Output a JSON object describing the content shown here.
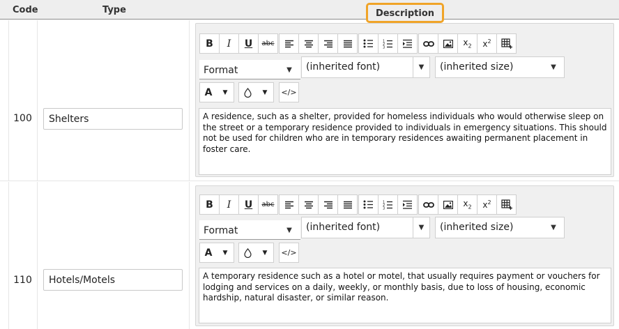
{
  "table": {
    "headers": {
      "code": "Code",
      "type": "Type",
      "description": "Description"
    },
    "rows": [
      {
        "code": "100",
        "type": "Shelters",
        "description": "A residence, such as a shelter, provided for homeless individuals who would otherwise sleep on the street or a temporary residence provided to individuals in emergency situations. This should not be used for children who are in temporary residences awaiting permanent placement in foster care."
      },
      {
        "code": "110",
        "type": "Hotels/Motels",
        "description": "A temporary residence such as a hotel or motel, that usually requires payment or vouchers for lodging and services on a daily, weekly, or monthly basis, due to loss of housing, economic hardship, natural disaster, or similar reason."
      }
    ]
  },
  "editor": {
    "toolbar": {
      "bold": "B",
      "italic": "I",
      "underline": "U",
      "strikethrough": "abc",
      "subscript_icon": "subscript-icon",
      "superscript_icon": "superscript-icon"
    },
    "format_select": "Format",
    "font_select": "(inherited font)",
    "size_select": "(inherited size)",
    "text_color_label": "A",
    "source_label": "</>"
  },
  "colors": {
    "highlight": "#f0a428",
    "header_bg": "#eeeeee",
    "editor_bg": "#f0f0f0"
  }
}
